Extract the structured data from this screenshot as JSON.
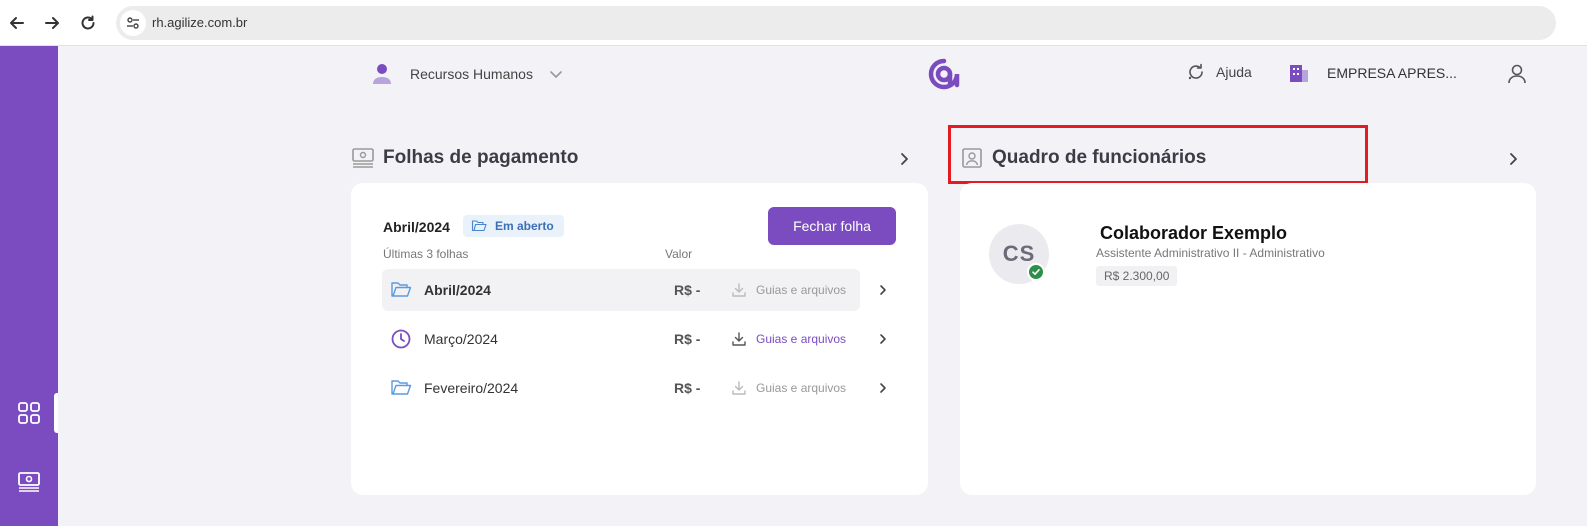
{
  "browser": {
    "url": "rh.agilize.com.br",
    "back_icon": "arrow-left-icon",
    "forward_icon": "arrow-right-icon",
    "reload_icon": "reload-icon"
  },
  "sidebar": {
    "items": [
      {
        "icon": "dashboard-grid-icon"
      },
      {
        "icon": "payroll-icon"
      }
    ],
    "color": "#7b4cc0"
  },
  "header": {
    "module_label": "Recursos Humanos",
    "help_label": "Ajuda",
    "company_label": "EMPRESA APRES..."
  },
  "payroll": {
    "title": "Folhas de pagamento",
    "current_period": "Abril/2024",
    "status": "Em aberto",
    "close_button": "Fechar folha",
    "col_last": "Últimas 3 folhas",
    "col_value": "Valor",
    "rows": [
      {
        "label": "Abril/2024",
        "value": "R$ -",
        "link": "Guias e arquivos",
        "icon": "folder-open-icon",
        "link_enabled": false
      },
      {
        "label": "Março/2024",
        "value": "R$ -",
        "link": "Guias e arquivos",
        "icon": "clock-icon",
        "link_enabled": true
      },
      {
        "label": "Fevereiro/2024",
        "value": "R$ -",
        "link": "Guias e arquivos",
        "icon": "folder-open-icon",
        "link_enabled": false
      }
    ]
  },
  "employees": {
    "title": "Quadro de funcionários",
    "employee": {
      "initials": "CS",
      "name": "Colaborador Exemplo",
      "role": "Assistente Administrativo II - Administrativo",
      "salary": "R$ 2.300,00"
    }
  },
  "colors": {
    "accent": "#7b4cc0",
    "highlight": "#e41b23",
    "success": "#2e8f4c"
  }
}
